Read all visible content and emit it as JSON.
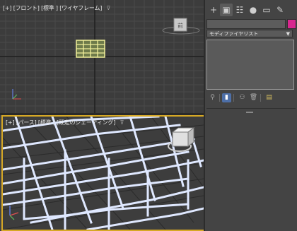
{
  "viewports": {
    "top": {
      "label": "[+] [フロント] [標準 ] [ワイヤフレーム]",
      "filter_icon": "funnel-icon",
      "viewcube_face": "前"
    },
    "perspective": {
      "label": "[+] [パース] [標準 ] [既定のシェーディング]",
      "filter_icon": "funnel-icon"
    }
  },
  "command_panel": {
    "tabs": [
      {
        "icon": "create-icon",
        "glyph": "+"
      },
      {
        "icon": "modify-icon",
        "glyph": "▣"
      },
      {
        "icon": "hierarchy-icon",
        "glyph": "☷"
      },
      {
        "icon": "motion-icon",
        "glyph": "●"
      },
      {
        "icon": "display-icon",
        "glyph": "▭"
      },
      {
        "icon": "utilities-icon",
        "glyph": "✎"
      }
    ],
    "modifier_list": "モディファイヤリスト",
    "dropdown_arrow": "▼",
    "object_color": "#d8278f",
    "stack_tools": [
      {
        "icon": "pin-stack-icon",
        "glyph": "⚲"
      },
      {
        "icon": "show-end-result-icon",
        "glyph": "▮"
      },
      {
        "icon": "make-unique-icon",
        "glyph": "⚇"
      },
      {
        "icon": "remove-modifier-icon",
        "glyph": "🗑"
      },
      {
        "icon": "configure-sets-icon",
        "glyph": "▤"
      }
    ]
  },
  "colors": {
    "selection": "#d6a825",
    "viewport_bg": "#3c3c3c",
    "wire": "#dfe8ff"
  }
}
